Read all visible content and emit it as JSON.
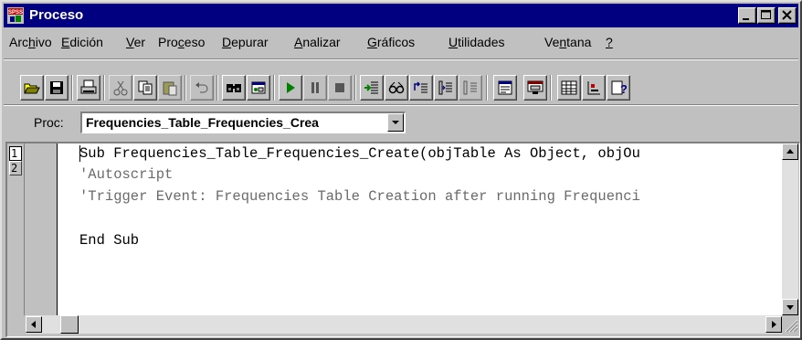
{
  "window": {
    "title": "Proceso",
    "app_icon": "spss-app-icon",
    "buttons": {
      "minimize": "minimize-icon",
      "maximize": "maximize-icon",
      "close": "close-icon"
    }
  },
  "menu": {
    "items": [
      {
        "pre": "Arc",
        "key": "h",
        "post": "ivo"
      },
      {
        "pre": "",
        "key": "E",
        "post": "dición"
      },
      {
        "pre": "",
        "key": "V",
        "post": "er"
      },
      {
        "pre": "Pro",
        "key": "c",
        "post": "eso"
      },
      {
        "pre": "",
        "key": "D",
        "post": "epurar"
      },
      {
        "pre": "",
        "key": "A",
        "post": "nalizar"
      },
      {
        "pre": "",
        "key": "G",
        "post": "ráficos"
      },
      {
        "pre": "",
        "key": "U",
        "post": "tilidades"
      },
      {
        "pre": "Ve",
        "key": "n",
        "post": "tana"
      },
      {
        "pre": "",
        "key": "?",
        "post": ""
      }
    ]
  },
  "toolbar": {
    "icons": [
      "open-icon",
      "save-icon",
      "print-icon",
      "cut-icon",
      "copy-icon",
      "paste-icon",
      "undo-icon",
      "find-icon",
      "dialog-icon",
      "run-icon",
      "pause-icon",
      "stop-icon",
      "step-into-icon",
      "watch-icon",
      "step-over-icon",
      "step-out-icon",
      "call-stack-icon",
      "object-browser-icon",
      "dialog-editor-icon",
      "table-icon",
      "toggle-breakpoint-icon",
      "help-icon"
    ]
  },
  "proc": {
    "label": "Proc:",
    "value": "Frequencies_Table_Frequencies_Crea"
  },
  "editor": {
    "line_numbers": [
      "1",
      "2"
    ],
    "lines": [
      {
        "text": "Sub Frequencies_Table_Frequencies_Create(objTable As Object, objOu",
        "comment": false
      },
      {
        "text": "'Autoscript",
        "comment": true
      },
      {
        "text": "'Trigger Event: Frequencies Table Creation after running Frequenci",
        "comment": true
      },
      {
        "text": "",
        "comment": false
      },
      {
        "text": "End Sub",
        "comment": false
      }
    ]
  },
  "colors": {
    "titlebar": "#000080",
    "face": "#c0c0c0",
    "run_green": "#008000",
    "comment": "#6a6a6a"
  }
}
